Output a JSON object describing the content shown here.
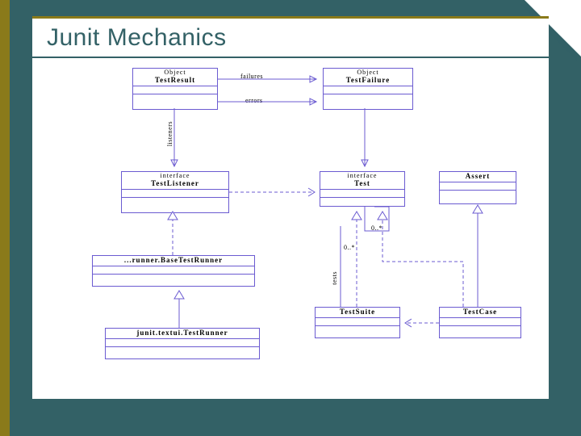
{
  "slide": {
    "title": "Junit Mechanics"
  },
  "classes": {
    "testResult": {
      "stereo": "Object",
      "name": "TestResult"
    },
    "testFailure": {
      "stereo": "Object",
      "name": "TestFailure"
    },
    "testListener": {
      "stereo": "interface",
      "name": "TestListener"
    },
    "testInterface": {
      "stereo": "interface",
      "name": "Test"
    },
    "assert": {
      "stereo": "",
      "name": "Assert"
    },
    "baseRunner": {
      "stereo": "",
      "name": "...runner.BaseTestRunner"
    },
    "testSuite": {
      "stereo": "",
      "name": "TestSuite"
    },
    "testCase": {
      "stereo": "",
      "name": "TestCase"
    },
    "textRunner": {
      "stereo": "",
      "name": "junit.textui.TestRunner"
    }
  },
  "assocs": {
    "failures": "failures",
    "errors": "errors",
    "listeners": "listeners",
    "tests": "tests",
    "mult1": "0..*",
    "mult2": "0..*"
  },
  "diagram_data": {
    "type": "uml-class-diagram",
    "nodes": [
      {
        "id": "TestResult",
        "stereotype": "Object"
      },
      {
        "id": "TestFailure",
        "stereotype": "Object"
      },
      {
        "id": "TestListener",
        "stereotype": "interface"
      },
      {
        "id": "Test",
        "stereotype": "interface"
      },
      {
        "id": "Assert"
      },
      {
        "id": "BaseTestRunner",
        "label": "...runner.BaseTestRunner"
      },
      {
        "id": "TestSuite"
      },
      {
        "id": "TestCase"
      },
      {
        "id": "TextTestRunner",
        "label": "junit.textui.TestRunner"
      }
    ],
    "edges": [
      {
        "from": "TestResult",
        "to": "TestFailure",
        "kind": "association",
        "label": "failures"
      },
      {
        "from": "TestResult",
        "to": "TestFailure",
        "kind": "association",
        "label": "errors"
      },
      {
        "from": "TestResult",
        "to": "TestListener",
        "kind": "association",
        "label": "listeners"
      },
      {
        "from": "TestFailure",
        "to": "Test",
        "kind": "association"
      },
      {
        "from": "BaseTestRunner",
        "to": "TestListener",
        "kind": "realization"
      },
      {
        "from": "TextTestRunner",
        "to": "BaseTestRunner",
        "kind": "generalization"
      },
      {
        "from": "TestSuite",
        "to": "Test",
        "kind": "realization"
      },
      {
        "from": "TestCase",
        "to": "Test",
        "kind": "realization"
      },
      {
        "from": "TestCase",
        "to": "Assert",
        "kind": "generalization"
      },
      {
        "from": "TestSuite",
        "to": "Test",
        "kind": "association",
        "label": "tests",
        "mult": "0..*"
      },
      {
        "from": "Test",
        "to": "Test",
        "kind": "self-association",
        "mult": "0..*"
      },
      {
        "from": "TestListener",
        "to": "Test",
        "kind": "dependency"
      },
      {
        "from": "TestCase",
        "to": "TestSuite",
        "kind": "dependency"
      }
    ]
  }
}
